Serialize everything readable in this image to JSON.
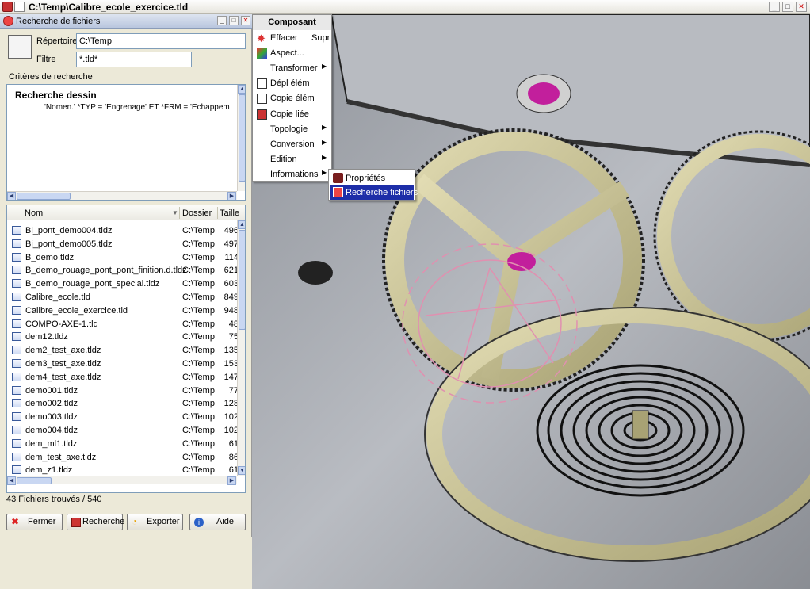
{
  "window": {
    "title": "C:\\Temp\\Calibre_ecole_exercice.tld",
    "minimize": "_",
    "maximize": "□",
    "close": "✕"
  },
  "search_panel": {
    "title": "Recherche de fichiers",
    "repertoire_label": "Répertoire",
    "repertoire_value": "C:\\Temp",
    "filtre_label": "Filtre",
    "filtre_value": "*.tld*",
    "criteria_caption": "Critères de recherche",
    "criteria_title": "Recherche dessin",
    "criteria_expression": "'Nomen.' *TYP = 'Engrenage' ET *FRM = 'Echappem",
    "columns": [
      "Nom",
      "Dossier",
      "Taille"
    ],
    "files": [
      {
        "name": "Bi_pont_demo004.tldz",
        "dir": "C:\\Temp",
        "size": "496"
      },
      {
        "name": "Bi_pont_demo005.tldz",
        "dir": "C:\\Temp",
        "size": "497"
      },
      {
        "name": "B_demo.tldz",
        "dir": "C:\\Temp",
        "size": "114"
      },
      {
        "name": "B_demo_rouage_pont_pont_finition.d.tldz",
        "dir": "C:\\Temp",
        "size": "621"
      },
      {
        "name": "B_demo_rouage_pont_special.tldz",
        "dir": "C:\\Temp",
        "size": "603"
      },
      {
        "name": "Calibre_ecole.tld",
        "dir": "C:\\Temp",
        "size": "849"
      },
      {
        "name": "Calibre_ecole_exercice.tld",
        "dir": "C:\\Temp",
        "size": "948"
      },
      {
        "name": "COMPO-AXE-1.tld",
        "dir": "C:\\Temp",
        "size": "48"
      },
      {
        "name": "dem12.tldz",
        "dir": "C:\\Temp",
        "size": "75"
      },
      {
        "name": "dem2_test_axe.tldz",
        "dir": "C:\\Temp",
        "size": "135"
      },
      {
        "name": "dem3_test_axe.tldz",
        "dir": "C:\\Temp",
        "size": "153"
      },
      {
        "name": "dem4_test_axe.tldz",
        "dir": "C:\\Temp",
        "size": "147"
      },
      {
        "name": "demo001.tldz",
        "dir": "C:\\Temp",
        "size": "77"
      },
      {
        "name": "demo002.tldz",
        "dir": "C:\\Temp",
        "size": "128"
      },
      {
        "name": "demo003.tldz",
        "dir": "C:\\Temp",
        "size": "102"
      },
      {
        "name": "demo004.tldz",
        "dir": "C:\\Temp",
        "size": "102"
      },
      {
        "name": "dem_ml1.tldz",
        "dir": "C:\\Temp",
        "size": "61"
      },
      {
        "name": "dem_test_axe.tldz",
        "dir": "C:\\Temp",
        "size": "86"
      },
      {
        "name": "dem_z1.tldz",
        "dir": "C:\\Temp",
        "size": "61"
      }
    ],
    "status": "43 Fichiers trouvés / 540",
    "buttons": {
      "fermer": "Fermer",
      "recherche": "Recherche",
      "exporter": "Exporter",
      "aide": "Aide"
    }
  },
  "context_menu": {
    "header": "Composant",
    "items": [
      {
        "label": "Effacer",
        "shortcut": "Supr",
        "icon": "delete-star-icon"
      },
      {
        "label": "Aspect...",
        "icon": "aspect-icon"
      },
      {
        "label": "Transformer",
        "submenu": true
      },
      {
        "label": "Dépl élém",
        "icon": "move-element-icon"
      },
      {
        "label": "Copie élém",
        "icon": "copy-element-icon"
      },
      {
        "label": "Copie liée",
        "icon": "linked-copy-icon"
      },
      {
        "label": "Topologie",
        "submenu": true
      },
      {
        "label": "Conversion",
        "submenu": true
      },
      {
        "label": "Edition",
        "submenu": true
      },
      {
        "label": "Informations",
        "submenu": true
      }
    ],
    "submenu_items": [
      {
        "label": "Propriétés",
        "icon": "properties-icon"
      },
      {
        "label": "Recherche fichiers",
        "icon": "file-search-icon",
        "selected": true
      }
    ]
  },
  "colors": {
    "menu_highlight": "#1d2ea8",
    "gear_brass": "#cfc89a",
    "highlight_outline": "#e090b0",
    "jewel": "#c21f9c"
  }
}
